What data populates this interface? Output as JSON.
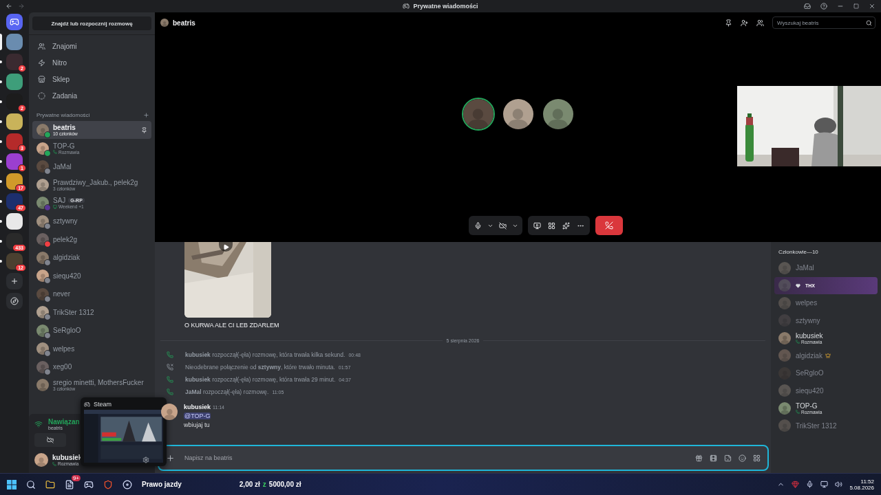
{
  "titlebar": {
    "title": "Prywatne wiadomości"
  },
  "servers": [
    {
      "color": "#6a8caf",
      "unread": false,
      "selected": true
    },
    {
      "color": "#3a2a30",
      "unread": true,
      "selected": false,
      "badge": "2"
    },
    {
      "color": "#3e9e7a",
      "unread": true,
      "selected": false
    },
    {
      "color": "#1c1c1c",
      "unread": true,
      "selected": false,
      "badge": "2"
    },
    {
      "color": "#c9b35a",
      "unread": true,
      "selected": false
    },
    {
      "color": "#b52a2a",
      "unread": true,
      "selected": false,
      "badge": "3"
    },
    {
      "color": "#9b3fd0",
      "unread": true,
      "selected": false,
      "badge": "1"
    },
    {
      "color": "#d09a2a",
      "unread": true,
      "selected": false,
      "badge": "17"
    },
    {
      "color": "#1d2f6e",
      "unread": true,
      "selected": false,
      "badge": "47"
    },
    {
      "color": "#e8e8e8",
      "unread": true,
      "selected": false
    },
    {
      "color": "#2a2a2a",
      "unread": true,
      "selected": false,
      "badge": "433"
    },
    {
      "color": "#4a4030",
      "unread": true,
      "selected": false,
      "badge": "12"
    }
  ],
  "sidebar": {
    "search": "Znajdź lub rozpocznij rozmowę",
    "nav": [
      {
        "kind": "friends",
        "label": "Znajomi"
      },
      {
        "kind": "nitro",
        "label": "Nitro"
      },
      {
        "kind": "shop",
        "label": "Sklep"
      },
      {
        "kind": "quests",
        "label": "Zadania"
      }
    ],
    "dm_header": "Prywatne wiadomości",
    "dms": [
      {
        "name": "beatris",
        "sub": "10 członków",
        "kind": "group",
        "color": "#23a55a",
        "selected": true,
        "pinned": true
      },
      {
        "name": "TOP-G",
        "sub": "Rozmawia",
        "kind": "call",
        "color": "#23a55a",
        "selected": false
      },
      {
        "name": "JaMal",
        "kind": "plain",
        "color": "#80848e",
        "selected": false
      },
      {
        "name": "Prawdziwy_Jakub., pelek2g",
        "sub": "3 członków",
        "kind": "group",
        "selected": false
      },
      {
        "name": "SAJ",
        "tag": "G-RP",
        "sub": "Weekend +1",
        "kind": "activity",
        "color": "#593695",
        "selected": false
      },
      {
        "name": "sztywny",
        "kind": "plain",
        "color": "#80848e",
        "selected": false
      },
      {
        "name": "pelek2g",
        "kind": "plain",
        "color": "#f23f43",
        "selected": false
      },
      {
        "name": "algidziak",
        "kind": "plain",
        "color": "#80848e",
        "selected": false
      },
      {
        "name": "siequ420",
        "kind": "plain",
        "color": "#80848e",
        "selected": false
      },
      {
        "name": "never",
        "kind": "plain",
        "color": "#80848e",
        "selected": false
      },
      {
        "name": "TrikSter 1312",
        "kind": "plain",
        "color": "#80848e",
        "selected": false
      },
      {
        "name": "SeRgloO",
        "kind": "plain",
        "color": "#80848e",
        "selected": false
      },
      {
        "name": "welpes",
        "kind": "plain",
        "color": "#80848e",
        "selected": false
      },
      {
        "name": "xeg00",
        "kind": "plain",
        "color": "#80848e",
        "selected": false
      },
      {
        "name": "sregio minetti, MothersFucker",
        "sub": "3 członków",
        "kind": "group",
        "selected": false
      }
    ],
    "voice": {
      "status": "Nawiązan",
      "channel": "beatris"
    },
    "user": {
      "name": "kubusiek",
      "sub": "Rozmawia"
    },
    "popup": {
      "title": "Steam"
    }
  },
  "call": {
    "channel": "beatris",
    "search_placeholder": "Wyszukaj beatris",
    "participants": [
      {
        "speaking": true
      },
      {
        "speaking": false
      },
      {
        "speaking": false
      }
    ]
  },
  "chat": {
    "caption": "O KURWA ALE CI LEB ZDARLEM",
    "date": "5 sierpnia 2026",
    "log": [
      {
        "kind": "call",
        "text": "**kubusiek** rozpoczął(-ęła) rozmowę, która trwała kilka sekund.",
        "time": "00:48"
      },
      {
        "kind": "missed",
        "text": "Nieodebrane połączenie od **sztywny**, które trwało minuta.",
        "time": "01:57"
      },
      {
        "kind": "call",
        "text": "**kubusiek** rozpoczął(-ęła) rozmowę, która trwała 29 minut.",
        "time": "04:37"
      },
      {
        "kind": "call",
        "text": "**JaMal** rozpoczął(-ęła) rozmowę.",
        "time": "11:05"
      }
    ],
    "message": {
      "author": "kubusiek",
      "time": "11:14",
      "mention": "@TOP-G",
      "text": "wbiujaj tu"
    },
    "placeholder": "Napisz na beatris"
  },
  "members": {
    "title": "Członkowie—10",
    "list": [
      {
        "name": "JaMal",
        "offline": true
      },
      {
        "tag": "THX",
        "offline": true,
        "highlight": true
      },
      {
        "name": "welpes",
        "offline": true
      },
      {
        "name": "sztywny",
        "offline": true
      },
      {
        "name": "kubusiek",
        "offline": false,
        "sub": "Rozmawia"
      },
      {
        "name": "algidziak",
        "offline": true,
        "crown": true
      },
      {
        "name": "SeRgloO",
        "offline": true
      },
      {
        "name": "siequ420",
        "offline": true
      },
      {
        "name": "TOP-G",
        "offline": false,
        "sub": "Rozmawia"
      },
      {
        "name": "TrikSter 1312",
        "offline": true
      }
    ]
  },
  "taskbar": {
    "notes_badge": "9+",
    "pinned_text": "Prawo jazdy",
    "progress": "2,00 zł",
    "progress_sep": "z",
    "goal": "5000,00 zł",
    "time": "11:52",
    "date": "5.08.2026"
  }
}
